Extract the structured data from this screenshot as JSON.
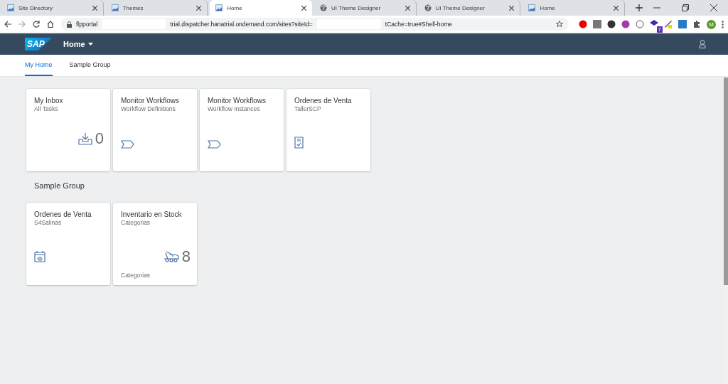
{
  "browser": {
    "tabs": [
      {
        "title": "Site Directory",
        "selected": false
      },
      {
        "title": "Themes",
        "selected": false
      },
      {
        "title": "Home",
        "selected": true
      },
      {
        "title": "UI Theme Designer",
        "selected": false
      },
      {
        "title": "UI Theme Designer",
        "selected": false
      },
      {
        "title": "Home",
        "selected": false
      }
    ],
    "url_parts": [
      "flpportal",
      "trial.dispatcher.hanatrial.ondemand.com/sites?siteId=",
      "tCache=true#Shell-home"
    ],
    "extension_badge": "7",
    "profile_initial": "M"
  },
  "shell": {
    "logo": "SAP",
    "title": "Home"
  },
  "anchor_tabs": [
    {
      "label": "My Home",
      "selected": true
    },
    {
      "label": "Sample Group",
      "selected": false
    }
  ],
  "groups": [
    {
      "tiles": [
        {
          "kind": "numeric",
          "title": "My Inbox",
          "subtitle": "All Tasks",
          "number": "0"
        },
        {
          "kind": "icon",
          "title": "Monitor Workflows",
          "subtitle": "Workflow Definitions"
        },
        {
          "kind": "icon",
          "title": "Monitor Workflows",
          "subtitle": "Workflow Instances"
        },
        {
          "kind": "icon",
          "title": "Ordenes de Venta",
          "subtitle": "TallerSCP"
        }
      ]
    },
    {
      "title": "Sample Group",
      "tiles": [
        {
          "kind": "icon",
          "title": "Ordenes de Venta",
          "subtitle": "S4Salinas"
        },
        {
          "kind": "numeric",
          "title": "Inventario en Stock",
          "subtitle": "Categorias",
          "number": "8",
          "footer": "Categorias"
        }
      ]
    }
  ]
}
